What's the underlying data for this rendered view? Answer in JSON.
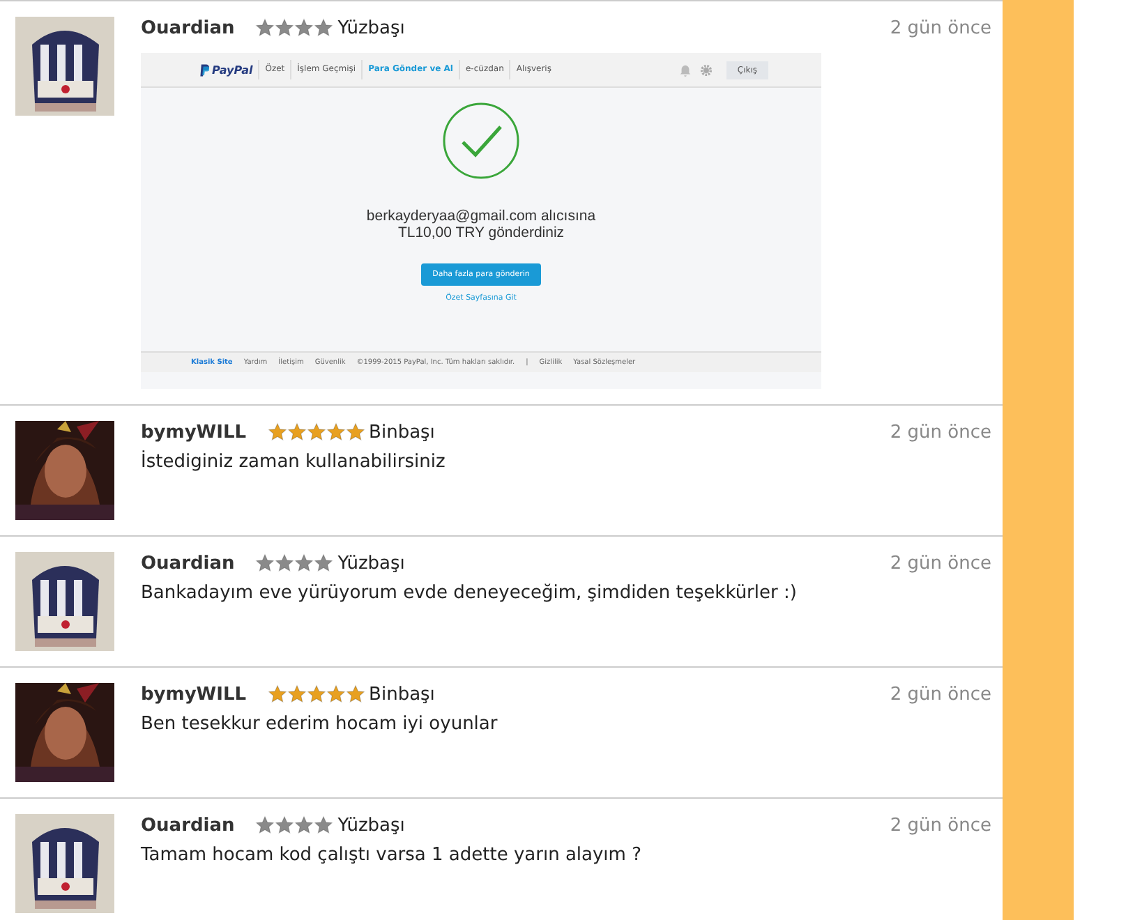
{
  "comments": [
    {
      "author": "Ouardian",
      "stars": 4,
      "color": "#8a8a8a",
      "rank": "Yüzbaşı",
      "time": "2 gün önce",
      "kind": "screenshot",
      "attachment": {
        "logo": "PayPal",
        "nav": [
          {
            "label": "Özet",
            "selected": false
          },
          {
            "label": "İşlem Geçmişi",
            "selected": false
          },
          {
            "label": "Para Gönder ve Al",
            "selected": true
          },
          {
            "label": "e-cüzdan",
            "selected": false
          },
          {
            "label": "Alışveriş",
            "selected": false
          }
        ],
        "logout": "Çıkış",
        "message": [
          "berkayderyaa@gmail.com alıcısına",
          "TL10,00 TRY gönderdiniz"
        ],
        "primary_button": "Daha fazla para gönderin",
        "link": "Özet Sayfasına Git",
        "footer": [
          {
            "label": "Klasik Site",
            "selected": true
          },
          {
            "label": "Yardım",
            "selected": false
          },
          {
            "label": "İletişim",
            "selected": false
          },
          {
            "label": "Güvenlik",
            "selected": false
          },
          {
            "label": "©1999-2015 PayPal, Inc. Tüm hakları saklıdır.",
            "selected": false
          },
          {
            "label": "|",
            "selected": false
          },
          {
            "label": "Gizlilik",
            "selected": false
          },
          {
            "label": "Yasal Sözleşmeler",
            "selected": false
          }
        ]
      }
    },
    {
      "author": "bymyWILL",
      "stars": 5,
      "color": "#e8a020",
      "rank": "Binbaşı",
      "time": "2 gün önce",
      "kind": "text",
      "text": "İstediginiz zaman kullanabilirsiniz"
    },
    {
      "author": "Ouardian",
      "stars": 4,
      "color": "#8a8a8a",
      "rank": "Yüzbaşı",
      "time": "2 gün önce",
      "kind": "text",
      "text": "Bankadayım eve yürüyorum evde deneyeceğim, şimdiden teşekkürler :)"
    },
    {
      "author": "bymyWILL",
      "stars": 5,
      "color": "#e8a020",
      "rank": "Binbaşı",
      "time": "2 gün önce",
      "kind": "text",
      "text": "Ben tesekkur ederim hocam iyi oyunlar"
    },
    {
      "author": "Ouardian",
      "stars": 4,
      "color": "#8a8a8a",
      "rank": "Yüzbaşı",
      "time": "2 gün önce",
      "kind": "text",
      "text": "Tamam hocam kod çalıştı varsa 1 adette yarın alayım ?"
    }
  ]
}
